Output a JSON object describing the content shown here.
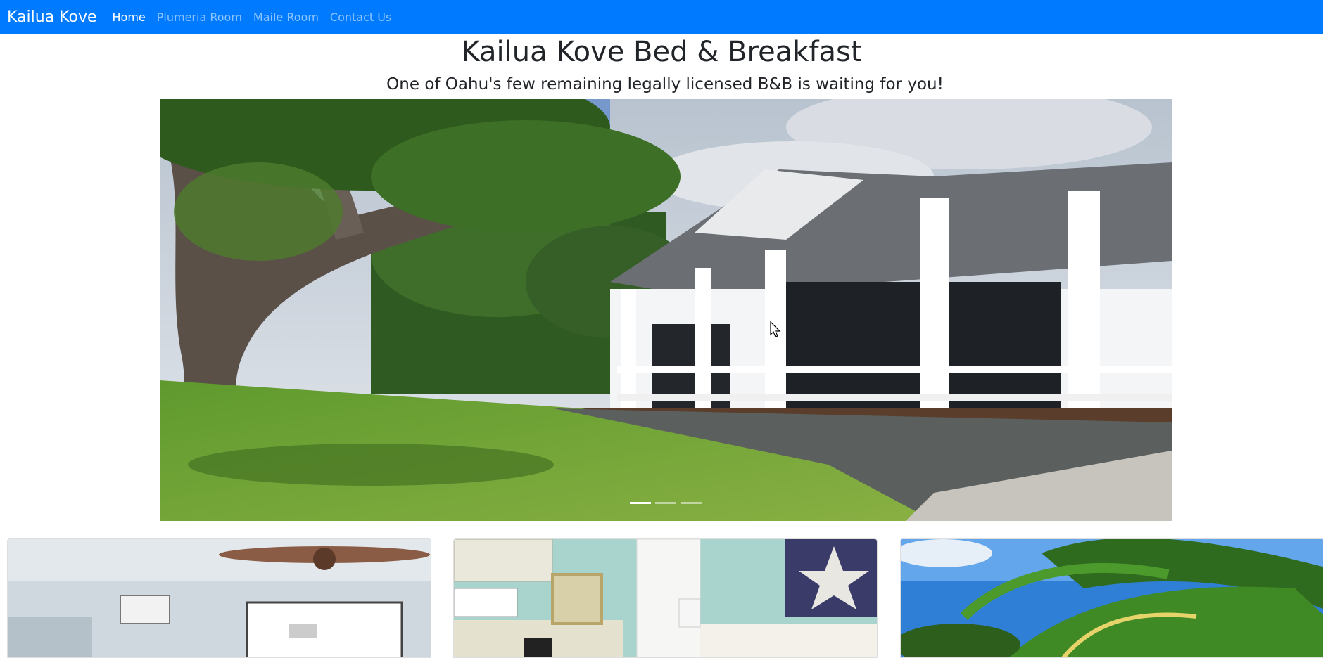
{
  "navbar": {
    "brand": "Kailua Kove",
    "links": [
      {
        "label": "Home",
        "active": true
      },
      {
        "label": "Plumeria Room",
        "active": false
      },
      {
        "label": "Maile Room",
        "active": false
      },
      {
        "label": "Contact Us",
        "active": false
      }
    ],
    "background": "#007bff"
  },
  "header": {
    "title": "Kailua Kove Bed & Breakfast",
    "subtitle": "One of Oahu's few remaining legally licensed B&B is waiting for you!"
  },
  "carousel": {
    "slide_count": 3,
    "active_slide": 1
  },
  "cards": [
    {
      "icon": "living-room-photo"
    },
    {
      "icon": "kitchenette-room-photo"
    },
    {
      "icon": "palm-tree-photo"
    }
  ]
}
